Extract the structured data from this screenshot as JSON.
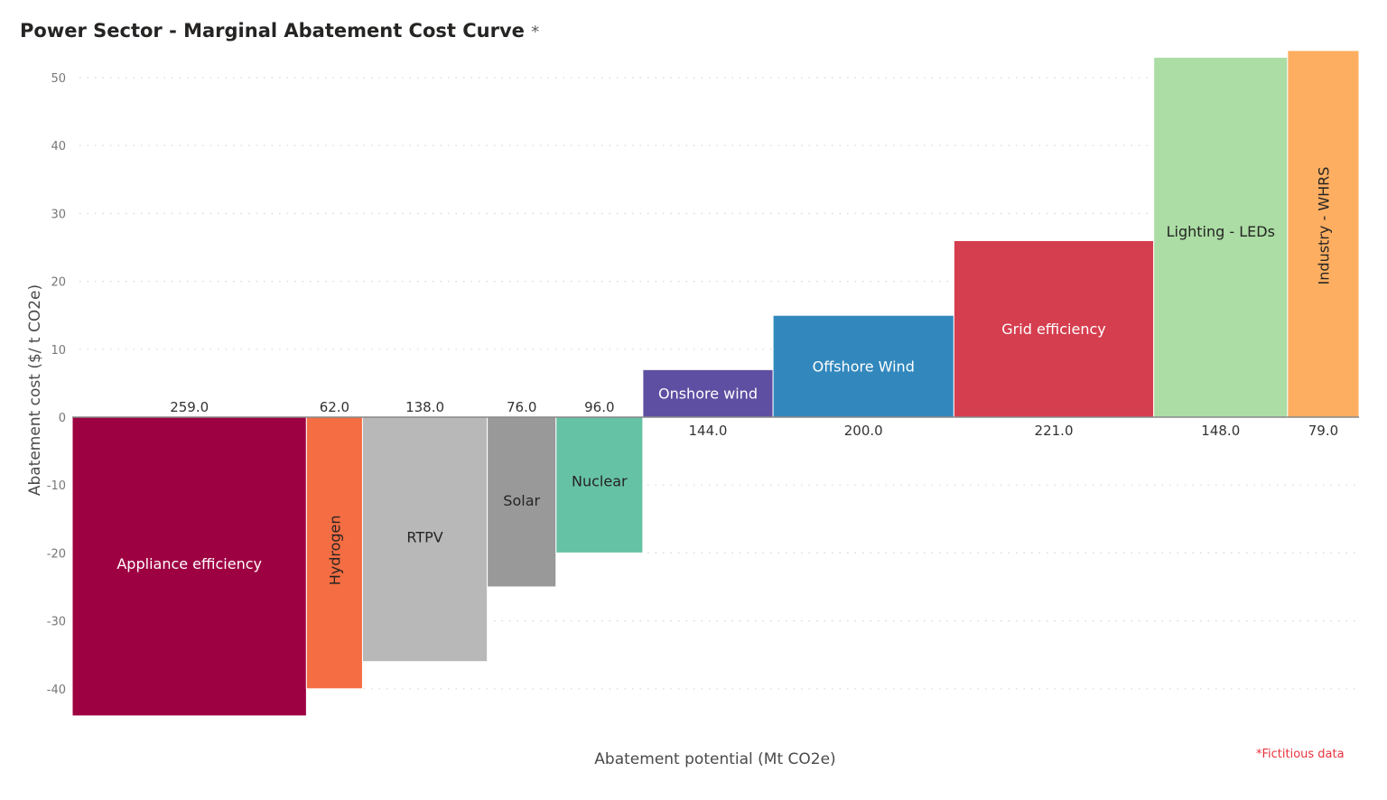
{
  "chart_data": {
    "type": "bar",
    "subtype": "variable-width (marginal abatement cost curve)",
    "title": "Power Sector - Marginal Abatement Cost Curve",
    "title_suffix": "*",
    "xlabel": "Abatement potential (Mt CO2e)",
    "ylabel": "Abatement cost ($/ t CO2e)",
    "ylim": [
      -44,
      54
    ],
    "yticks": [
      50,
      40,
      30,
      20,
      10,
      0,
      -10,
      -20,
      -30,
      -40
    ],
    "grid": true,
    "footnote": "*Fictitious data",
    "categories": [
      "Appliance efficiency",
      "Hydrogen",
      "RTPV",
      "Solar",
      "Nuclear",
      "Onshore wind",
      "Offshore Wind",
      "Grid efficiency",
      "Lighting - LEDs",
      "Industry - WHRS"
    ],
    "widths": [
      259,
      62,
      138,
      76,
      96,
      144,
      200,
      221,
      148,
      79
    ],
    "width_labels": [
      "259.0",
      "62.0",
      "138.0",
      "76.0",
      "96.0",
      "144.0",
      "200.0",
      "221.0",
      "148.0",
      "79.0"
    ],
    "values": [
      -44,
      -40,
      -36,
      -25,
      -20,
      7,
      15,
      26,
      53,
      54
    ],
    "colors": [
      "#9e0142",
      "#f46d43",
      "#b8b8b8",
      "#999999",
      "#66c2a5",
      "#5e4fa2",
      "#3288bd",
      "#d53e4f",
      "#abdda4",
      "#fdae61"
    ],
    "label_colors": [
      "#ffffff",
      "#252423",
      "#252423",
      "#252423",
      "#252423",
      "#ffffff",
      "#ffffff",
      "#ffffff",
      "#252423",
      "#252423"
    ],
    "label_vertical": [
      false,
      true,
      false,
      false,
      false,
      false,
      false,
      false,
      false,
      true
    ]
  }
}
